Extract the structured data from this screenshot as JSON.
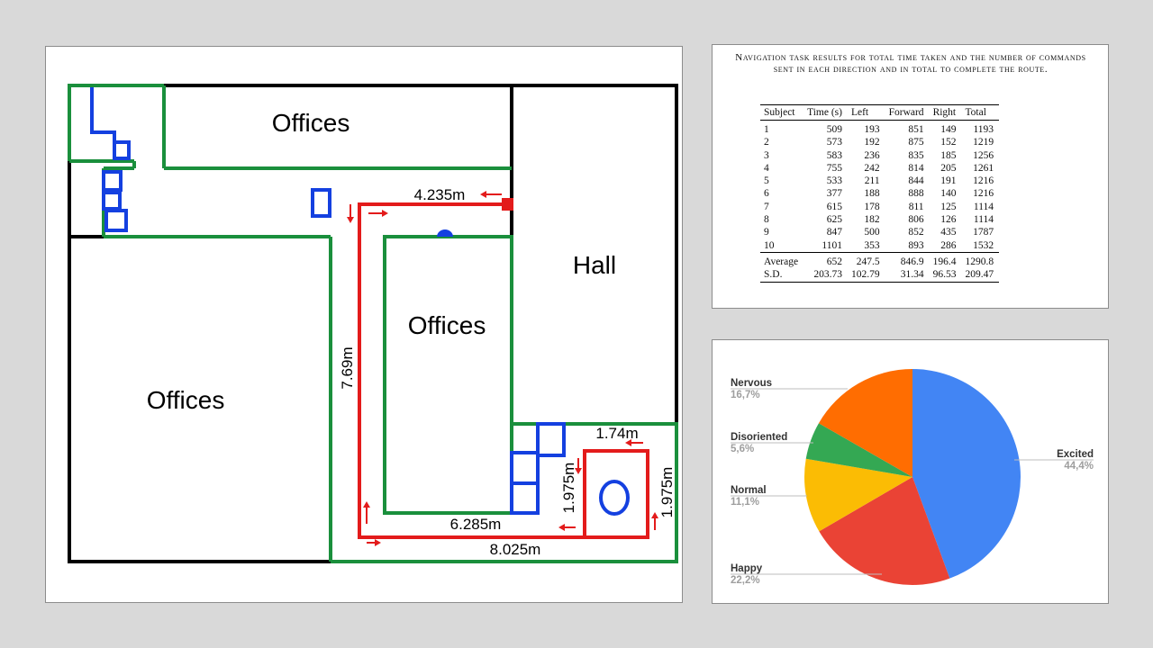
{
  "map": {
    "rooms": {
      "offices_top": "Offices",
      "offices_left": "Offices",
      "offices_center": "Offices",
      "hall": "Hall"
    },
    "dimensions": {
      "d1": "4.235m",
      "d2": "7.69m",
      "d3": "6.285m",
      "d4": "8.025m",
      "d5": "1.74m",
      "d6": "1.975m",
      "d7": "1.975m"
    },
    "colors": {
      "wall": "#000000",
      "area": "#1a8f3c",
      "route": "#e31b1b",
      "obstacle": "#1440e0"
    }
  },
  "table": {
    "caption": "Navigation task results for total time taken and the number of commands sent in each direction and in total to complete the route.",
    "columns": [
      "Subject",
      "Time (s)",
      "Left",
      "Forward",
      "Right",
      "Total"
    ],
    "rows": [
      [
        "1",
        "509",
        "193",
        "851",
        "149",
        "1193"
      ],
      [
        "2",
        "573",
        "192",
        "875",
        "152",
        "1219"
      ],
      [
        "3",
        "583",
        "236",
        "835",
        "185",
        "1256"
      ],
      [
        "4",
        "755",
        "242",
        "814",
        "205",
        "1261"
      ],
      [
        "5",
        "533",
        "211",
        "844",
        "191",
        "1216"
      ],
      [
        "6",
        "377",
        "188",
        "888",
        "140",
        "1216"
      ],
      [
        "7",
        "615",
        "178",
        "811",
        "125",
        "1114"
      ],
      [
        "8",
        "625",
        "182",
        "806",
        "126",
        "1114"
      ],
      [
        "9",
        "847",
        "500",
        "852",
        "435",
        "1787"
      ],
      [
        "10",
        "1101",
        "353",
        "893",
        "286",
        "1532"
      ]
    ],
    "summary": [
      [
        "Average",
        "652",
        "247.5",
        "846.9",
        "196.4",
        "1290.8"
      ],
      [
        "S.D.",
        "203.73",
        "102.79",
        "31.34",
        "96.53",
        "209.47"
      ]
    ]
  },
  "chart_data": {
    "type": "pie",
    "slices": [
      {
        "name": "Excited",
        "label": "44,4%",
        "value": 44.4,
        "color": "#4285f4"
      },
      {
        "name": "Happy",
        "label": "22,2%",
        "value": 22.2,
        "color": "#ea4335"
      },
      {
        "name": "Normal",
        "label": "11,1%",
        "value": 11.1,
        "color": "#fbbc04"
      },
      {
        "name": "Disoriented",
        "label": "5,6%",
        "value": 5.6,
        "color": "#34a853"
      },
      {
        "name": "Nervous",
        "label": "16,7%",
        "value": 16.7,
        "color": "#ff6d01"
      }
    ]
  }
}
